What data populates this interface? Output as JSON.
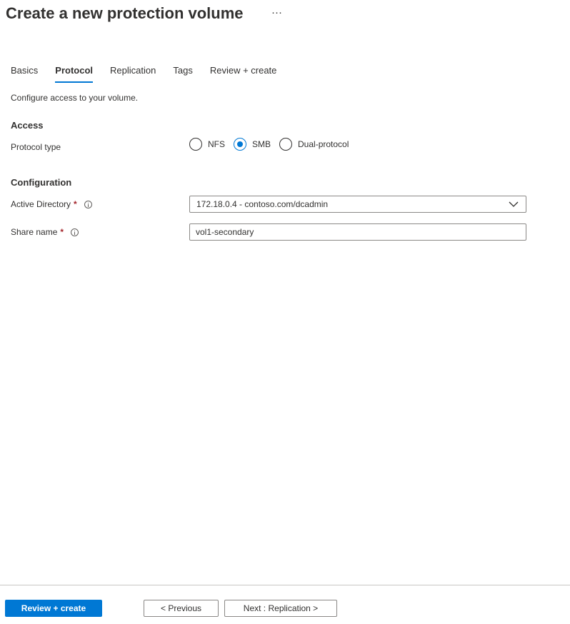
{
  "header": {
    "title": "Create a new protection volume",
    "more_label": "···"
  },
  "tabs": [
    {
      "label": "Basics",
      "active": false
    },
    {
      "label": "Protocol",
      "active": true
    },
    {
      "label": "Replication",
      "active": false
    },
    {
      "label": "Tags",
      "active": false
    },
    {
      "label": "Review + create",
      "active": false
    }
  ],
  "description": "Configure access to your volume.",
  "access": {
    "heading": "Access",
    "protocol_type": {
      "label": "Protocol type",
      "options": [
        "NFS",
        "SMB",
        "Dual-protocol"
      ],
      "selected": "SMB"
    }
  },
  "configuration": {
    "heading": "Configuration",
    "active_directory": {
      "label": "Active Directory",
      "required_mark": "*",
      "value": "172.18.0.4 - contoso.com/dcadmin"
    },
    "share_name": {
      "label": "Share name",
      "required_mark": "*",
      "value": "vol1-secondary"
    }
  },
  "footer": {
    "review_create": "Review + create",
    "previous": "< Previous",
    "next": "Next : Replication >"
  },
  "colors": {
    "accent": "#0078d4",
    "required": "#a4262c",
    "text": "#323130",
    "border": "#8a8886"
  },
  "icons": {
    "info": "info-icon",
    "chevron": "chevron-down-icon",
    "more": "more-icon"
  }
}
